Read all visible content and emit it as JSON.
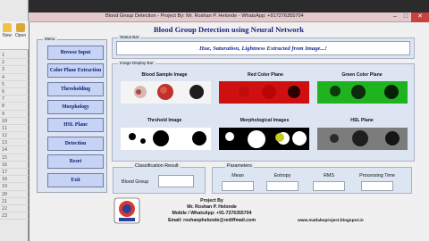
{
  "ide": {
    "tools": [
      {
        "label": "New",
        "icon": "new-file-icon",
        "color": "#f0c24a"
      },
      {
        "label": "Open",
        "icon": "open-folder-icon",
        "color": "#d9a83b"
      }
    ],
    "line_numbers": [
      "1",
      "2",
      "3",
      "4",
      "5",
      "6",
      "7",
      "8",
      "9",
      "10",
      "11",
      "12",
      "13",
      "14",
      "15",
      "16",
      "17",
      "18",
      "19",
      "20",
      "21",
      "22",
      "23"
    ]
  },
  "window": {
    "title": "Blood Group Detection  -  Project By: Mr. Roshan P. Helonde  -  WhatsApp: +917276355704",
    "controls": [
      "–",
      "□",
      "✕"
    ]
  },
  "app_title": "Blood Group Detection using Neural Network",
  "menu": {
    "label": "Menu",
    "buttons": [
      "Browse Input",
      "Color Plane Extraction",
      "Thresholding",
      "Morphology",
      "HSL Plane",
      "Detection",
      "Reset",
      "Exit"
    ]
  },
  "status_bar": {
    "label": "Status Bar",
    "message": "Hue, Saturation, Lightness Extracted from Image...!"
  },
  "image_display": {
    "label": "Image Display Bar",
    "images": [
      {
        "title": "Blood Sample Image",
        "kind": "sample"
      },
      {
        "title": "Red Color Plane",
        "kind": "red"
      },
      {
        "title": "Green Color Plane",
        "kind": "green"
      },
      {
        "title": "Thrshold Image",
        "kind": "threshold"
      },
      {
        "title": "Morphological Images",
        "kind": "morph"
      },
      {
        "title": "HSL Plane",
        "kind": "hsl"
      }
    ]
  },
  "classification": {
    "label": "Classification Result",
    "field_label": "Blood Group",
    "value": ""
  },
  "parameters": {
    "label": "Parameters",
    "fields": [
      {
        "label": "Mean",
        "value": ""
      },
      {
        "label": "Entropy",
        "value": ""
      },
      {
        "label": "RMS",
        "value": ""
      },
      {
        "label": "Processing Time",
        "value": ""
      }
    ]
  },
  "footer": {
    "line1": "Project By",
    "line2": "Mr. Roshan P. Helonde",
    "line3": "Mobile / WhatsApp: +91-7276355704",
    "line4": "Email: roshanphelonde@rediffmail.com",
    "website": "www.matlabsproject.blogspot.in"
  }
}
